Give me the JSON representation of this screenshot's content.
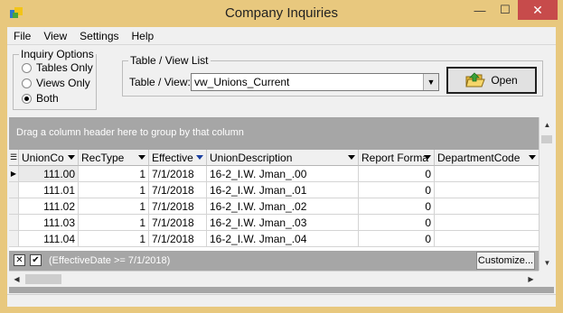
{
  "window": {
    "title": "Company Inquiries",
    "controls": {
      "minimize": "—",
      "maximize": "☐",
      "close": "✕"
    }
  },
  "menu": {
    "items": [
      {
        "label": "File"
      },
      {
        "label": "View"
      },
      {
        "label": "Settings"
      },
      {
        "label": "Help"
      }
    ]
  },
  "inquiry_options": {
    "title": "Inquiry Options",
    "options": [
      {
        "label": "Tables Only",
        "checked": false
      },
      {
        "label": "Views Only",
        "checked": false
      },
      {
        "label": "Both",
        "checked": true
      }
    ]
  },
  "table_view_list": {
    "title": "Table / View List",
    "label": "Table / View:",
    "value": "vw_Unions_Current",
    "open_label": "Open"
  },
  "grid": {
    "group_hint": "Drag a column header here to group by that column",
    "columns": [
      {
        "label": "UnionCo",
        "filter_active": false
      },
      {
        "label": "RecType",
        "filter_active": false
      },
      {
        "label": "Effective",
        "filter_active": true
      },
      {
        "label": "UnionDescription",
        "filter_active": false
      },
      {
        "label": "Report Forma",
        "filter_active": false
      },
      {
        "label": "DepartmentCode",
        "filter_active": false
      }
    ],
    "rows": [
      {
        "current": true,
        "cells": [
          "111.00",
          "1",
          "7/1/2018",
          "16-2_I.W. Jman_.00",
          "0",
          ""
        ]
      },
      {
        "current": false,
        "cells": [
          "111.01",
          "1",
          "7/1/2018",
          "16-2_I.W. Jman_.01",
          "0",
          ""
        ]
      },
      {
        "current": false,
        "cells": [
          "111.02",
          "1",
          "7/1/2018",
          "16-2_I.W. Jman_.02",
          "0",
          ""
        ]
      },
      {
        "current": false,
        "cells": [
          "111.03",
          "1",
          "7/1/2018",
          "16-2_I.W. Jman_.03",
          "0",
          ""
        ]
      },
      {
        "current": false,
        "cells": [
          "111.04",
          "1",
          "7/1/2018",
          "16-2_I.W. Jman_.04",
          "0",
          ""
        ]
      }
    ],
    "filter_text": "(EffectiveDate >= 7/1/2018)",
    "customize_label": "Customize..."
  },
  "colors": {
    "title_bar": "#e8c87e",
    "close_button": "#c74b4b",
    "grid_background": "#a6a6a6",
    "filter_arrow_active": "#1a3fa0"
  }
}
